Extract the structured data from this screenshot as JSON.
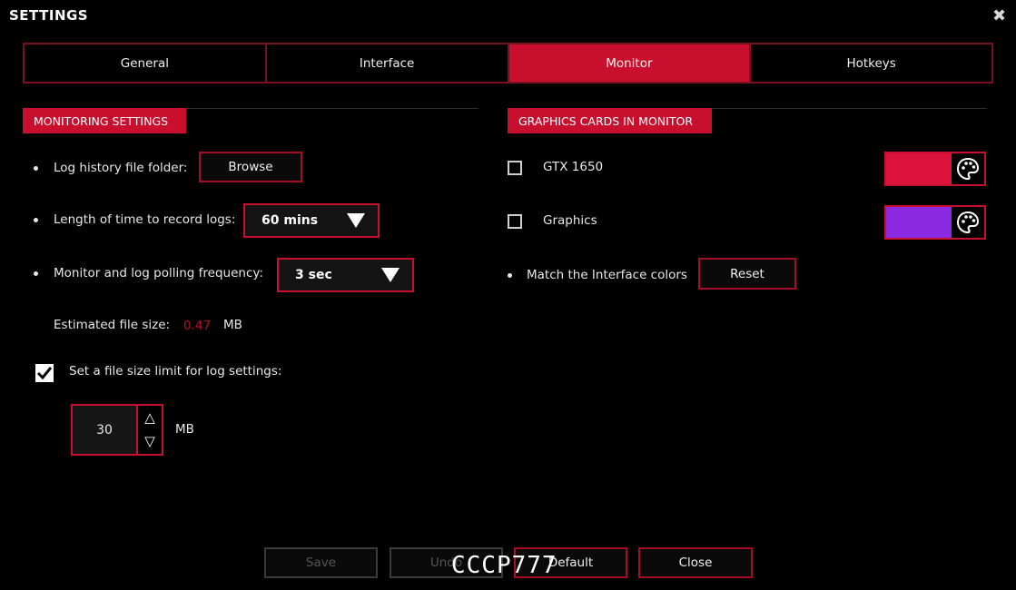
{
  "window": {
    "title": "SETTINGS",
    "close_glyph": "✖"
  },
  "tabs": [
    {
      "label": "General",
      "active": false
    },
    {
      "label": "Interface",
      "active": false
    },
    {
      "label": "Monitor",
      "active": true
    },
    {
      "label": "Hotkeys",
      "active": false
    }
  ],
  "monitoring": {
    "header": "MONITORING SETTINGS",
    "log_folder_label": "Log history file folder:",
    "browse_label": "Browse",
    "record_length_label": "Length of time to record logs:",
    "record_length_value": "60 mins",
    "polling_label": "Monitor and log polling frequency:",
    "polling_value": "3 sec",
    "est_size_label": "Estimated file size:",
    "est_size_value": "0.47",
    "est_size_unit": "MB",
    "limit_label": "Set a file size limit for log settings:",
    "limit_checked": true,
    "limit_value": "30",
    "limit_unit": "MB",
    "step_up": "△",
    "step_down": "▽"
  },
  "graphics": {
    "header": "GRAPHICS CARDS IN MONITOR",
    "cards": [
      {
        "name": "GTX 1650",
        "checked": false,
        "color": "#dc143c"
      },
      {
        "name": "Graphics",
        "checked": false,
        "color": "#8a2be2"
      }
    ],
    "match_label": "Match the Interface colors",
    "reset_label": "Reset"
  },
  "footer": {
    "save_label": "Save",
    "undo_label": "Undo",
    "default_label": "Default",
    "close_label": "Close"
  },
  "watermark": "CCCP777",
  "colors": {
    "accent": "#c8102e",
    "background": "#000000"
  }
}
